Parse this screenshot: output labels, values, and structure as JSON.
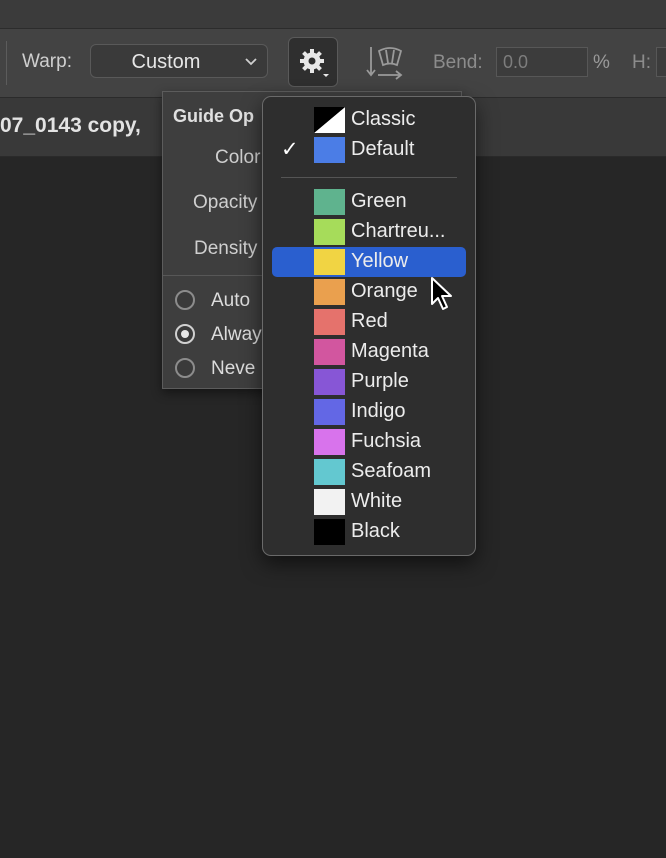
{
  "toolbar": {
    "warp_label": "Warp:",
    "warp_value": "Custom",
    "bend_label": "Bend:",
    "bend_value": "0.0",
    "percent": "%",
    "h_label": "H:"
  },
  "document": {
    "tab_title": "07_0143 copy,"
  },
  "guide_options": {
    "title": "Guide Op",
    "color_label": "Color",
    "opacity_label": "Opacity",
    "density_label": "Density",
    "modes": [
      {
        "label": "Auto",
        "selected": false
      },
      {
        "label": "Alway",
        "selected": true
      },
      {
        "label": "Neve",
        "selected": false
      }
    ]
  },
  "color_menu": {
    "items": [
      {
        "label": "Classic",
        "color": "classic"
      },
      {
        "label": "Default",
        "color": "#4b7de6",
        "checked": true
      },
      {
        "label": "Green",
        "color": "#5fb38e"
      },
      {
        "label": "Chartreu...",
        "color": "#a6dc5a"
      },
      {
        "label": "Yellow",
        "color": "#f1d443",
        "highlighted": true
      },
      {
        "label": "Orange",
        "color": "#eaa04e"
      },
      {
        "label": "Red",
        "color": "#e5726c"
      },
      {
        "label": "Magenta",
        "color": "#d2569f"
      },
      {
        "label": "Purple",
        "color": "#8756d6"
      },
      {
        "label": "Indigo",
        "color": "#6367e5"
      },
      {
        "label": "Fuchsia",
        "color": "#d873ec"
      },
      {
        "label": "Seafoam",
        "color": "#63c8d0"
      },
      {
        "label": "White",
        "color": "#f2f2f2"
      },
      {
        "label": "Black",
        "color": "#000000"
      }
    ]
  },
  "icons": [
    "chevron-down-icon",
    "gear-icon",
    "warp-orientation-icon",
    "checkmark-icon",
    "mouse-pointer-icon"
  ],
  "colors": {
    "highlight": "#2a5fcf",
    "background": "#262626"
  }
}
